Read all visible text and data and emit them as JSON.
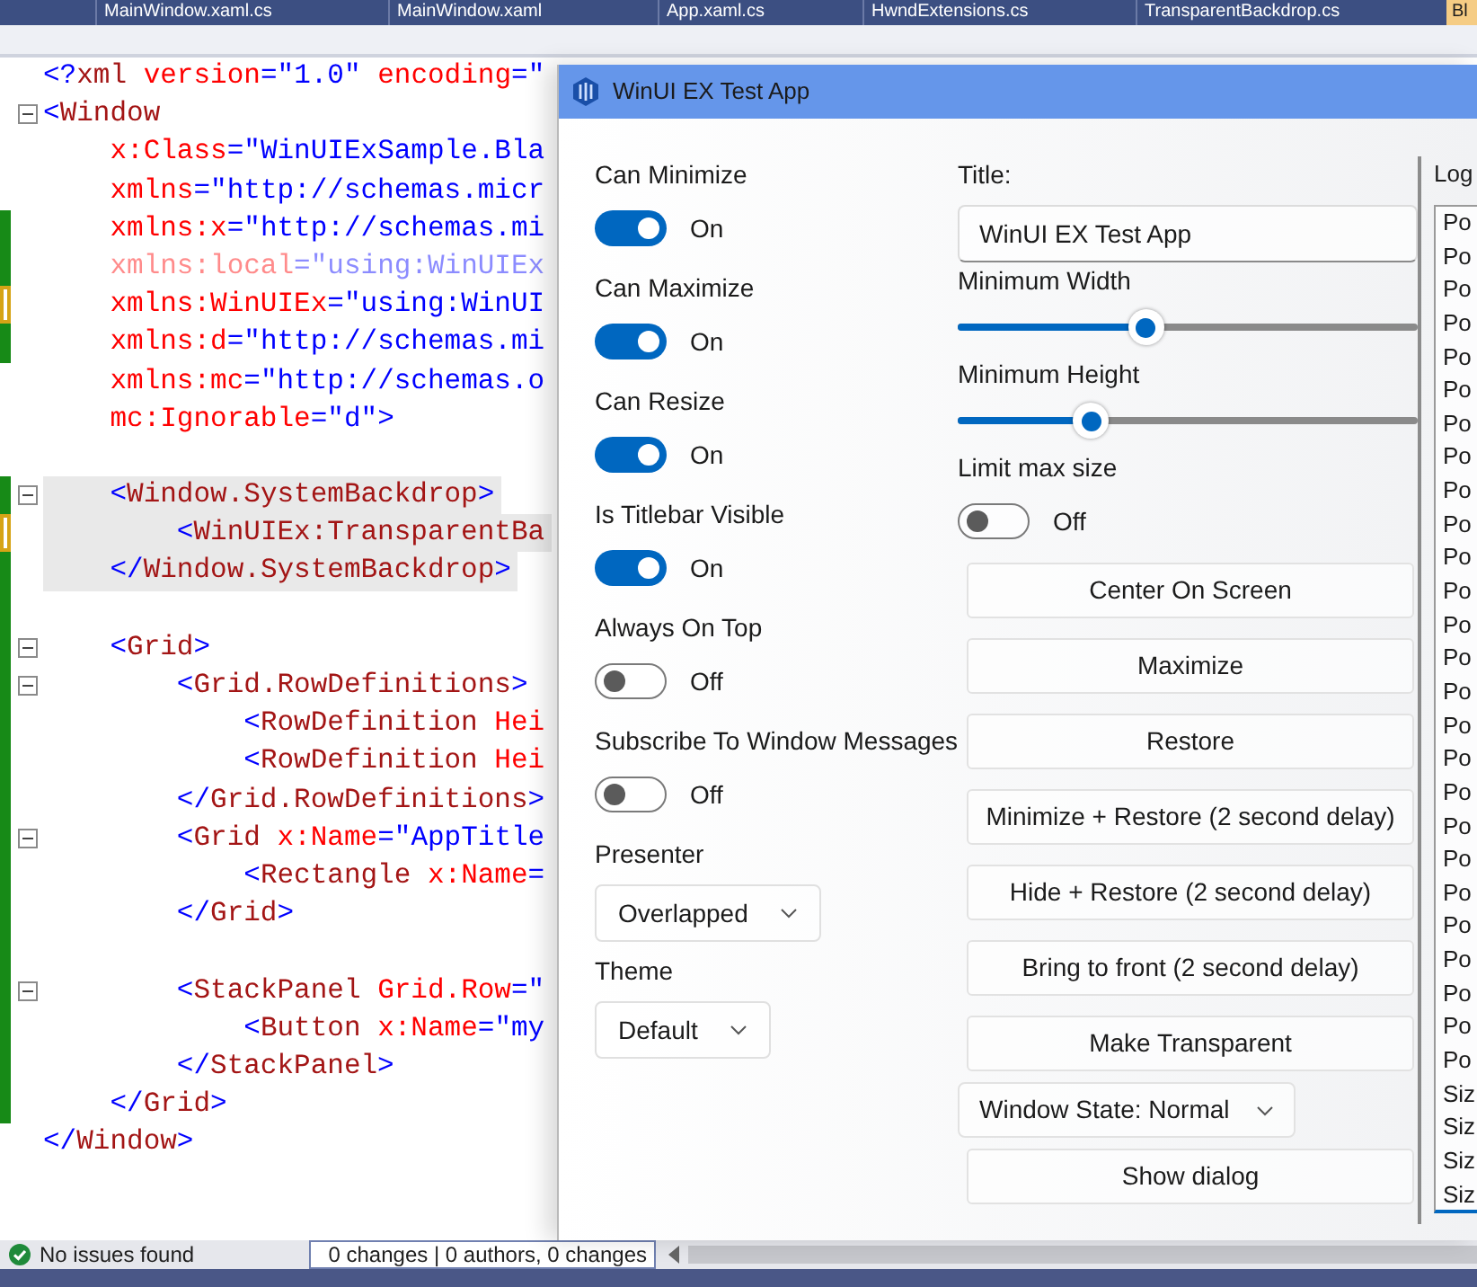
{
  "tabs": [
    {
      "label": "MainWindow.xaml.cs",
      "selected": false
    },
    {
      "label": "MainWindow.xaml",
      "selected": false
    },
    {
      "label": "App.xaml.cs",
      "selected": false
    },
    {
      "label": "HwndExtensions.cs",
      "selected": false
    },
    {
      "label": "TransparentBackdrop.cs",
      "selected": false
    },
    {
      "label": "Bl",
      "selected": true
    }
  ],
  "editor": {
    "lines": [
      {
        "text": "<?xml version=\"1.0\" encoding=\"",
        "collapsible": false,
        "changed": false,
        "unsaved": false,
        "highlighted": false,
        "faded": false
      },
      {
        "text": "<Window",
        "collapsible": true,
        "changed": false,
        "unsaved": false,
        "highlighted": false,
        "faded": false
      },
      {
        "text": "    x:Class=\"WinUIExSample.Bla",
        "collapsible": false,
        "changed": false,
        "unsaved": false,
        "highlighted": false,
        "faded": false
      },
      {
        "text": "    xmlns=\"http://schemas.micr",
        "collapsible": false,
        "changed": false,
        "unsaved": false,
        "highlighted": false,
        "faded": false
      },
      {
        "text": "    xmlns:x=\"http://schemas.mi",
        "collapsible": false,
        "changed": true,
        "unsaved": false,
        "highlighted": false,
        "faded": false
      },
      {
        "text": "    xmlns:local=\"using:WinUIEx",
        "collapsible": false,
        "changed": true,
        "unsaved": false,
        "highlighted": false,
        "faded": true
      },
      {
        "text": "    xmlns:WinUIEx=\"using:WinUI",
        "collapsible": false,
        "changed": false,
        "unsaved": true,
        "highlighted": false,
        "faded": false
      },
      {
        "text": "    xmlns:d=\"http://schemas.mi",
        "collapsible": false,
        "changed": true,
        "unsaved": false,
        "highlighted": false,
        "faded": false
      },
      {
        "text": "    xmlns:mc=\"http://schemas.o",
        "collapsible": false,
        "changed": false,
        "unsaved": false,
        "highlighted": false,
        "faded": false
      },
      {
        "text": "    mc:Ignorable=\"d\">",
        "collapsible": false,
        "changed": false,
        "unsaved": false,
        "highlighted": false,
        "faded": false
      },
      {
        "collapsible": false,
        "changed": false,
        "unsaved": false,
        "highlighted": false
      },
      {
        "text": "    <Window.SystemBackdrop>",
        "collapsible": true,
        "changed": true,
        "unsaved": false,
        "highlighted": true,
        "faded": false
      },
      {
        "text": "        <WinUIEx:TransparentBa",
        "collapsible": false,
        "changed": false,
        "unsaved": true,
        "highlighted": true,
        "faded": false
      },
      {
        "text": "    </Window.SystemBackdrop>",
        "collapsible": false,
        "changed": true,
        "unsaved": false,
        "highlighted": true,
        "faded": false
      },
      {
        "collapsible": false,
        "changed": true,
        "unsaved": false,
        "highlighted": false
      },
      {
        "text": "    <Grid>",
        "collapsible": true,
        "changed": true,
        "unsaved": false,
        "highlighted": false,
        "faded": false
      },
      {
        "text": "        <Grid.RowDefinitions>",
        "collapsible": true,
        "changed": true,
        "unsaved": false,
        "highlighted": false,
        "faded": false
      },
      {
        "text": "            <RowDefinition Hei",
        "collapsible": false,
        "changed": true,
        "unsaved": false,
        "highlighted": false,
        "faded": false
      },
      {
        "text": "            <RowDefinition Hei",
        "collapsible": false,
        "changed": true,
        "unsaved": false,
        "highlighted": false,
        "faded": false
      },
      {
        "text": "        </Grid.RowDefinitions>",
        "collapsible": false,
        "changed": true,
        "unsaved": false,
        "highlighted": false,
        "faded": false
      },
      {
        "text": "        <Grid x:Name=\"AppTitle",
        "collapsible": true,
        "changed": true,
        "unsaved": false,
        "highlighted": false,
        "faded": false
      },
      {
        "text": "            <Rectangle x:Name=",
        "collapsible": false,
        "changed": true,
        "unsaved": false,
        "highlighted": false,
        "faded": false
      },
      {
        "text": "        </Grid>",
        "collapsible": false,
        "changed": true,
        "unsaved": false,
        "highlighted": false,
        "faded": false
      },
      {
        "collapsible": false,
        "changed": true,
        "unsaved": false,
        "highlighted": false
      },
      {
        "text": "        <StackPanel Grid.Row=\"",
        "collapsible": true,
        "changed": true,
        "unsaved": false,
        "highlighted": false,
        "faded": false
      },
      {
        "text": "            <Button x:Name=\"my",
        "collapsible": false,
        "changed": true,
        "unsaved": false,
        "highlighted": false,
        "faded": false
      },
      {
        "text": "        </StackPanel>",
        "collapsible": false,
        "changed": true,
        "unsaved": false,
        "highlighted": false,
        "faded": false
      },
      {
        "text": "    </Grid>",
        "collapsible": false,
        "changed": true,
        "unsaved": false,
        "highlighted": false,
        "faded": false
      },
      {
        "text": "</Window>",
        "collapsible": false,
        "changed": false,
        "unsaved": false,
        "highlighted": false,
        "faded": false
      }
    ]
  },
  "app_window": {
    "title": "WinUI EX Test App",
    "options": [
      {
        "kind": "toggle",
        "label": "Can Minimize",
        "on": true,
        "state_text": "On"
      },
      {
        "kind": "toggle",
        "label": "Can Maximize",
        "on": true,
        "state_text": "On"
      },
      {
        "kind": "toggle",
        "label": "Can Resize",
        "on": true,
        "state_text": "On"
      },
      {
        "kind": "toggle",
        "label": "Is Titlebar Visible",
        "on": true,
        "state_text": "On"
      },
      {
        "kind": "toggle",
        "label": "Always On Top",
        "on": false,
        "state_text": "Off"
      },
      {
        "kind": "toggle",
        "label": "Subscribe To Window Messages",
        "on": false,
        "state_text": "Off"
      },
      {
        "kind": "combo",
        "label": "Presenter",
        "value": "Overlapped"
      },
      {
        "kind": "combo",
        "label": "Theme",
        "value": "Default"
      }
    ],
    "controls": [
      {
        "kind": "text",
        "label": "Title:",
        "value": "WinUI EX Test App"
      },
      {
        "kind": "slider",
        "label": "Minimum Width",
        "level": 0.41
      },
      {
        "kind": "slider",
        "label": "Minimum Height",
        "level": 0.29
      },
      {
        "kind": "toggle",
        "label": "Limit max size",
        "on": false,
        "state_text": "Off"
      },
      {
        "kind": "button",
        "label": "Center On Screen"
      },
      {
        "kind": "button",
        "label": "Maximize"
      },
      {
        "kind": "button",
        "label": "Restore"
      },
      {
        "kind": "button",
        "label": "Minimize + Restore (2 second delay)"
      },
      {
        "kind": "button",
        "label": "Hide + Restore (2 second delay)"
      },
      {
        "kind": "button",
        "label": "Bring to front (2 second delay)"
      },
      {
        "kind": "button",
        "label": "Make Transparent"
      },
      {
        "kind": "combo",
        "value": "Window State: Normal"
      },
      {
        "kind": "button",
        "label": "Show dialog"
      }
    ],
    "log": {
      "label": "Log",
      "entries": [
        "Po",
        "Po",
        "Po",
        "Po",
        "Po",
        "Po",
        "Po",
        "Po",
        "Po",
        "Po",
        "Po",
        "Po",
        "Po",
        "Po",
        "Po",
        "Po",
        "Po",
        "Po",
        "Po",
        "Po",
        "Po",
        "Po",
        "Po",
        "Po",
        "Po",
        "Po",
        "Siz",
        "Siz",
        "Siz",
        "Siz"
      ]
    }
  },
  "status_bar": {
    "issues": "No issues found",
    "changes": "0 changes | 0 authors, 0 changes"
  }
}
